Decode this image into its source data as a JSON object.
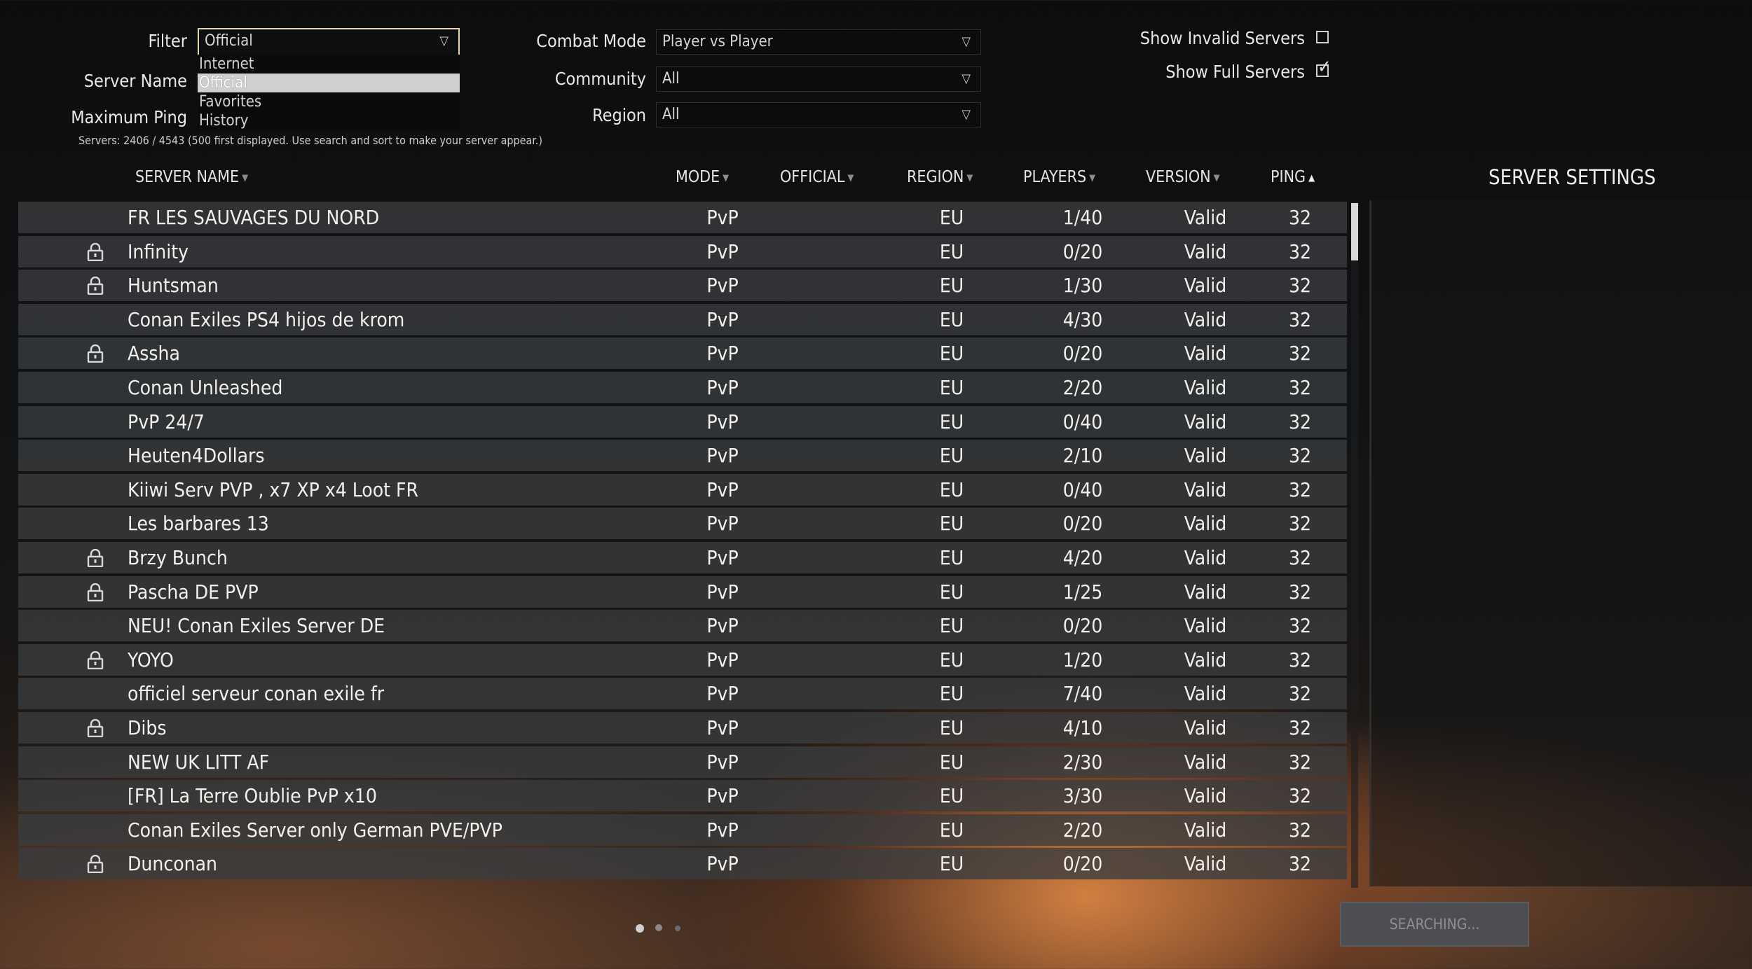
{
  "filters": {
    "filter": {
      "label": "Filter",
      "value": "Official",
      "options": [
        "Internet",
        "Official",
        "Favorites",
        "History"
      ]
    },
    "server_name": {
      "label": "Server Name"
    },
    "maximum_ping": {
      "label": "Maximum Ping"
    },
    "combat_mode": {
      "label": "Combat Mode",
      "value": "Player vs Player"
    },
    "community": {
      "label": "Community",
      "value": "All"
    },
    "region": {
      "label": "Region",
      "value": "All"
    },
    "show_invalid": {
      "label": "Show Invalid Servers",
      "checked": false
    },
    "show_full": {
      "label": "Show Full Servers",
      "checked": true
    }
  },
  "status": "Servers: 2406 / 4543 (500 first displayed. Use search and sort to make your server appear.)",
  "columns": {
    "server_name": "SERVER NAME",
    "mode": "MODE",
    "official": "OFFICIAL",
    "region": "REGION",
    "players": "PLAYERS",
    "version": "VERSION",
    "ping": "PING"
  },
  "sort": {
    "column": "ping",
    "direction": "ascending"
  },
  "servers": [
    {
      "name": "FR LES SAUVAGES DU NORD",
      "locked": false,
      "mode": "PvP",
      "region": "EU",
      "players": "1/40",
      "version": "Valid",
      "ping": "32"
    },
    {
      "name": "Infinity",
      "locked": true,
      "mode": "PvP",
      "region": "EU",
      "players": "0/20",
      "version": "Valid",
      "ping": "32"
    },
    {
      "name": "Huntsman",
      "locked": true,
      "mode": "PvP",
      "region": "EU",
      "players": "1/30",
      "version": "Valid",
      "ping": "32"
    },
    {
      "name": "Conan Exiles PS4 hijos de krom",
      "locked": false,
      "mode": "PvP",
      "region": "EU",
      "players": "4/30",
      "version": "Valid",
      "ping": "32"
    },
    {
      "name": "Assha",
      "locked": true,
      "mode": "PvP",
      "region": "EU",
      "players": "0/20",
      "version": "Valid",
      "ping": "32"
    },
    {
      "name": "Conan Unleashed",
      "locked": false,
      "mode": "PvP",
      "region": "EU",
      "players": "2/20",
      "version": "Valid",
      "ping": "32"
    },
    {
      "name": "PvP 24/7",
      "locked": false,
      "mode": "PvP",
      "region": "EU",
      "players": "0/40",
      "version": "Valid",
      "ping": "32"
    },
    {
      "name": "Heuten4Dollars",
      "locked": false,
      "mode": "PvP",
      "region": "EU",
      "players": "2/10",
      "version": "Valid",
      "ping": "32"
    },
    {
      "name": "Kiiwi Serv PVP , x7 XP x4 Loot FR",
      "locked": false,
      "mode": "PvP",
      "region": "EU",
      "players": "0/40",
      "version": "Valid",
      "ping": "32"
    },
    {
      "name": "Les barbares 13",
      "locked": false,
      "mode": "PvP",
      "region": "EU",
      "players": "0/20",
      "version": "Valid",
      "ping": "32"
    },
    {
      "name": "Brzy Bunch",
      "locked": true,
      "mode": "PvP",
      "region": "EU",
      "players": "4/20",
      "version": "Valid",
      "ping": "32"
    },
    {
      "name": "Pascha DE PVP",
      "locked": true,
      "mode": "PvP",
      "region": "EU",
      "players": "1/25",
      "version": "Valid",
      "ping": "32"
    },
    {
      "name": "NEU! Conan Exiles Server DE",
      "locked": false,
      "mode": "PvP",
      "region": "EU",
      "players": "0/20",
      "version": "Valid",
      "ping": "32"
    },
    {
      "name": "YOYO",
      "locked": true,
      "mode": "PvP",
      "region": "EU",
      "players": "1/20",
      "version": "Valid",
      "ping": "32"
    },
    {
      "name": "officiel serveur conan exile fr",
      "locked": false,
      "mode": "PvP",
      "region": "EU",
      "players": "7/40",
      "version": "Valid",
      "ping": "32"
    },
    {
      "name": "Dibs",
      "locked": true,
      "mode": "PvP",
      "region": "EU",
      "players": "4/10",
      "version": "Valid",
      "ping": "32"
    },
    {
      "name": "NEW UK LITT AF",
      "locked": false,
      "mode": "PvP",
      "region": "EU",
      "players": "2/30",
      "version": "Valid",
      "ping": "32"
    },
    {
      "name": "[FR] La Terre Oublie PvP x10",
      "locked": false,
      "mode": "PvP",
      "region": "EU",
      "players": "3/30",
      "version": "Valid",
      "ping": "32"
    },
    {
      "name": "Conan Exiles Server only German PVE/PVP",
      "locked": false,
      "mode": "PvP",
      "region": "EU",
      "players": "2/20",
      "version": "Valid",
      "ping": "32"
    },
    {
      "name": "Dunconan",
      "locked": true,
      "mode": "PvP",
      "region": "EU",
      "players": "0/20",
      "version": "Valid",
      "ping": "32"
    }
  ],
  "settings_panel": {
    "title": "SERVER SETTINGS"
  },
  "search_button": {
    "label": "SEARCHING..."
  },
  "pagination": {
    "pages": 3,
    "current": 1
  },
  "icons": {
    "lock": "lock-icon",
    "dropdown": "triangle-down-icon",
    "sort_up": "sort-ascending-icon",
    "sort_down": "sort-descending-icon",
    "checkbox": "checkbox-icon"
  },
  "colors": {
    "row_bg": "#3a3c3f",
    "accent_border": "#e6d7a8",
    "panel_bg": "#141618",
    "button_bg": "#4c4e51"
  }
}
